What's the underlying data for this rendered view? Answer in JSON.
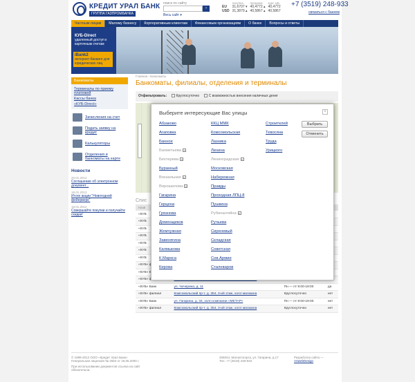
{
  "header": {
    "logo_title": "КРЕДИТ УРАЛ БАНК",
    "logo_subtitle": "ГРУППА ГАЗПРОМБАНКА",
    "search_label": "поиск по сайту",
    "search_button": "›",
    "all_sites": "Весь сайт ▾",
    "rates": {
      "col_buy": "покупка",
      "col_sell": "продажа",
      "col_cb": "курс ЦБ",
      "rows": [
        {
          "cur": "EU",
          "buy": "31,6707 ▾",
          "sell": "40,4772 ▴",
          "cb": "40,4772"
        },
        {
          "cur": "USD",
          "buy": "31,3879 ▴",
          "sell": "40,5867 ▴",
          "cb": "40,5867"
        }
      ]
    },
    "phone": "+7 (3519) 248-933",
    "contact_link": "связаться с банком"
  },
  "nav": [
    {
      "label": "Частным лицам",
      "active": true
    },
    {
      "label": "Малому бизнесу",
      "active": false
    },
    {
      "label": "Корпоративным клиентам",
      "active": false
    },
    {
      "label": "Финансовым организациям",
      "active": false
    },
    {
      "label": "О банке",
      "active": false
    },
    {
      "label": "Вопросы и ответы",
      "active": false
    }
  ],
  "banner": {
    "box1_title": "КУБ-Direct",
    "box1_text": "удаленный доступ к карточным счетам",
    "box2_title": "iBank2",
    "box2_text": "интернет-банкинг для юридических лиц"
  },
  "sidebar": {
    "head": "Банкоматы",
    "sub_items": [
      "Терминалы по приему платежей",
      "Кассы банка",
      "«КУБ-Direct»"
    ],
    "actions": [
      "Зачисления на счет",
      "Подать заявку на кредит",
      "Калькуляторы",
      "Отделения и банкоматы на карте"
    ],
    "news_title": "Новости",
    "news": [
      {
        "date": "20.01.2012",
        "text": "Соглашение об электронном документ..."
      },
      {
        "date": "18.01.2012",
        "text": "Итоги акции \"Новогодний фейерверк\""
      },
      {
        "date": "18.01.2012",
        "text": "Совершайте покупки и получайте скидки!"
      }
    ]
  },
  "main": {
    "breadcrumb": "Главная › Банкоматы",
    "title": "Банкоматы, филиалы, отделения и терминалы",
    "filter_label": "Отфильтровать:",
    "filter_opt1": "Круглосуточно",
    "filter_opt2": "С возможностью внесения наличных денег",
    "list_heading": "Спис",
    "table_headers": [
      "Назв",
      "",
      "",
      ""
    ],
    "rows": [
      {
        "name": "«КУБ",
        "addr": "",
        "hours": "",
        "cash": ""
      },
      {
        "name": "«КУБ",
        "addr": "",
        "hours": "",
        "cash": ""
      },
      {
        "name": "«КУБ",
        "addr": "",
        "hours": "",
        "cash": ""
      },
      {
        "name": "«КУБ",
        "addr": "",
        "hours": "",
        "cash": ""
      },
      {
        "name": "«КУБ",
        "addr": "",
        "hours": "",
        "cash": ""
      },
      {
        "name": "«КУБ",
        "addr": "",
        "hours": "",
        "cash": ""
      },
      {
        "name": "«КУБ",
        "addr": "",
        "hours": "",
        "cash": ""
      },
      {
        "name": "«КУБ» филиал",
        "addr": "Комсомольский пр-т, д. 354, 3-ий этаж, холл магазина",
        "hours": "Круглосуточно",
        "cash": "нет"
      },
      {
        "name": "«КУБ» Банк",
        "addr": "ул. Гагарина, д. 34, холл компании «МЕТАР»",
        "hours": "Пн — пт 9:00-19:00",
        "cash": "нет"
      },
      {
        "name": "«КУБ» филиал",
        "addr": "Комсомольский пр-т, д. 354, 3-ий этаж, холл магазина",
        "hours": "Круглосуточно",
        "cash": "нет"
      },
      {
        "name": "«КУБ» Банк",
        "addr": "ул. Чичерина, д. 11",
        "hours": "Пн — пт 9:00-19:00",
        "cash": "да"
      },
      {
        "name": "«КУБ» филиал",
        "addr": "Комсомольский пр-т, д. 354, 3-ий этаж, холл магазина",
        "hours": "Круглосуточно",
        "cash": "нет"
      },
      {
        "name": "«КУБ» Банк",
        "addr": "ул. Гагарина, д. 34, холл компании «МЕТАР»",
        "hours": "Пн — пт 9:00-19:00",
        "cash": "нет"
      },
      {
        "name": "«КУБ» филиал",
        "addr": "Комсомольский пр-т, д. 354, 3-ий этаж, холл магазина",
        "hours": "Круглосуточно",
        "cash": "нет"
      }
    ]
  },
  "footer": {
    "copyright": "© 1999-2012 ООО «Кредит Урал Банк»",
    "license": "Генеральная лицензия № 2584 от 18.05.2000 г.",
    "note": "При использовании документов ссылка на сайт обязательна.",
    "address": "455044, Магнитогорск, ул. Гагарина, д.17",
    "tel": "Тел. +7 (3519) 248-933",
    "dev_label": "Разработка сайта —",
    "dev_name": "ArtwebDesign"
  },
  "modal": {
    "title": "Выберите интересующие Вас улицы",
    "close": "×",
    "col1": [
      {
        "name": "Абзаково",
        "selected": false
      },
      {
        "name": "Агаповка",
        "selected": false
      },
      {
        "name": "Банное",
        "selected": false
      },
      {
        "name": "Бахметьева",
        "selected": true
      },
      {
        "name": "Бехтерева",
        "selected": true
      },
      {
        "name": "Буранный",
        "selected": false
      },
      {
        "name": "Вокзальная",
        "selected": true
      },
      {
        "name": "Ворошилова",
        "selected": true
      },
      {
        "name": "Гагарина",
        "selected": false
      },
      {
        "name": "Герцена",
        "selected": false
      },
      {
        "name": "Грязнова",
        "selected": false
      },
      {
        "name": "Доменщиков",
        "selected": false
      },
      {
        "name": "Жемчужная",
        "selected": false
      },
      {
        "name": "Завенягина",
        "selected": false
      },
      {
        "name": "Калмыкова",
        "selected": false
      },
      {
        "name": "К.Маркса",
        "selected": false
      },
      {
        "name": "Кирова",
        "selected": false
      }
    ],
    "col2": [
      {
        "name": "ККЦ ММК",
        "selected": false
      },
      {
        "name": "Комсомольская",
        "selected": false
      },
      {
        "name": "Лазника",
        "selected": false
      },
      {
        "name": "Ленина",
        "selected": false
      },
      {
        "name": "Ленинградская",
        "selected": true
      },
      {
        "name": "Московская",
        "selected": false
      },
      {
        "name": "Набережная",
        "selected": false
      },
      {
        "name": "Правды",
        "selected": false
      },
      {
        "name": "Проходная ЛПЦ-8",
        "selected": false
      },
      {
        "name": "Пушкина",
        "selected": false
      },
      {
        "name": "Рубинштейна",
        "selected": true
      },
      {
        "name": "Ручьева",
        "selected": false
      },
      {
        "name": "Сиреневый",
        "selected": false
      },
      {
        "name": "Складская",
        "selected": false
      },
      {
        "name": "Советская",
        "selected": false
      },
      {
        "name": "Сов.Армии",
        "selected": false
      },
      {
        "name": "Сталеваров",
        "selected": false
      }
    ],
    "col3": [
      {
        "name": "Строителей",
        "selected": false
      },
      {
        "name": "Тевосяна",
        "selected": false
      },
      {
        "name": "Труда",
        "selected": false
      },
      {
        "name": "Урицкого",
        "selected": false
      }
    ],
    "select_button": "Выбрать",
    "cancel_button": "Отменить"
  }
}
